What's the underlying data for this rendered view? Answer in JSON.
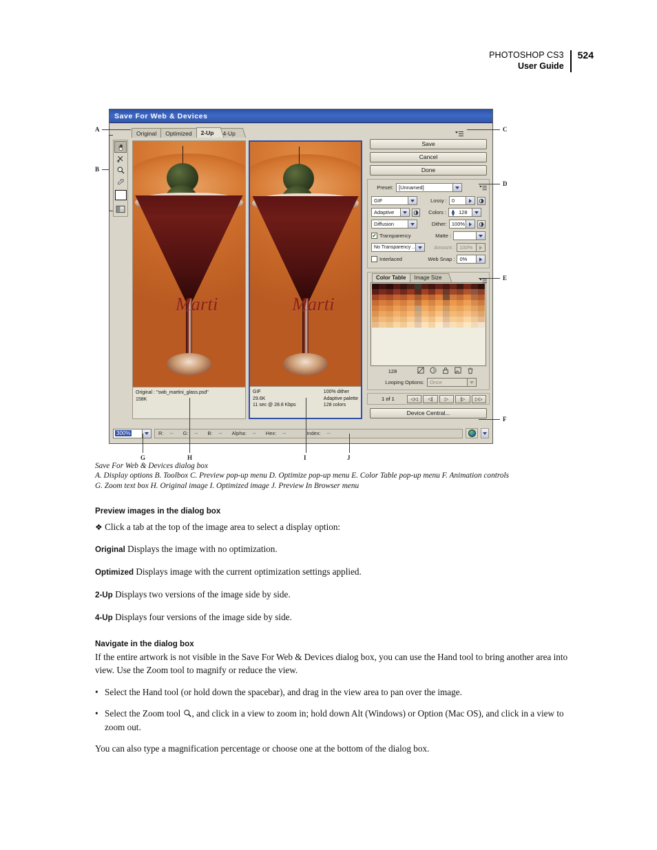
{
  "page_header": {
    "app": "PHOTOSHOP CS3",
    "guide": "User Guide",
    "page_number": "524"
  },
  "dialog": {
    "title": "Save For Web & Devices",
    "tabs": [
      {
        "label": "Original",
        "selected": false
      },
      {
        "label": "Optimized",
        "selected": false
      },
      {
        "label": "2-Up",
        "selected": true
      },
      {
        "label": "4-Up",
        "selected": false
      }
    ],
    "toolbox": [
      {
        "name": "hand-tool",
        "glyph": "✋",
        "active": true
      },
      {
        "name": "slice-select-tool",
        "glyph": "✂",
        "active": false
      },
      {
        "name": "zoom-tool",
        "glyph": "🔍",
        "active": false
      },
      {
        "name": "eyedropper-tool",
        "glyph": "✒",
        "active": false
      }
    ],
    "eyedropper_color": "#ffffff",
    "toggle_slices_label": "Toggle Slices Visibility",
    "buttons": {
      "save": "Save",
      "cancel": "Cancel",
      "done": "Done",
      "device_central": "Device Central..."
    },
    "panes": {
      "original": {
        "line1": "Original : \"swb_martini_glass.psd\"",
        "line2": "158K",
        "artwork_text": "Marti"
      },
      "optimized": {
        "left": [
          "GIF",
          "29.6K",
          "11 sec @ 28.8 Kbps"
        ],
        "right": [
          "100% dither",
          "Adaptive palette",
          "128 colors"
        ],
        "artwork_text": "Marti"
      }
    },
    "optimize": {
      "preset_label": "Preset:",
      "preset_value": "[Unnamed]",
      "format_value": "GIF",
      "palette_value": "Adaptive",
      "dither_algorithm_value": "Diffusion",
      "transparency_label": "Transparency",
      "transparency_checked": true,
      "transparency_dither_value": "No Transparency ..",
      "interlaced_label": "Interlaced",
      "interlaced_checked": false,
      "lossy_label": "Lossy :",
      "lossy_value": "0",
      "colors_label": "Colors :",
      "colors_value": "128",
      "dither_label": "Dither:",
      "dither_value": "100%",
      "matte_label": "Matte :",
      "matte_value": "",
      "amount_label": "Amount :",
      "amount_value": "100%",
      "amount_disabled": true,
      "web_snap_label": "Web Snap :",
      "web_snap_value": "0%"
    },
    "color_table": {
      "tabs": [
        {
          "label": "Color Table",
          "selected": true
        },
        {
          "label": "Image Size",
          "selected": false
        }
      ],
      "count": "128",
      "footer_icons": [
        "map-to-web-palette-icon",
        "transparency-icon",
        "lock-color-icon",
        "new-color-icon",
        "delete-color-icon"
      ],
      "swatch_colors": [
        "#2a0c08",
        "#3d1410",
        "#2c0d09",
        "#521a12",
        "#3a1410",
        "#4b2017",
        "#3c3a2e",
        "#561c13",
        "#431412",
        "#5e2016",
        "#4a1711",
        "#6a2418",
        "#3f1a13",
        "#73281a",
        "#4a1a12",
        "#2e100c",
        "#5b1d14",
        "#7a2a1b",
        "#66231a",
        "#8b3421",
        "#6e2a1c",
        "#97381f",
        "#5f2a1e",
        "#a54023",
        "#7b3220",
        "#b14a26",
        "#6b3a28",
        "#a14a2b",
        "#8b4226",
        "#b4552c",
        "#8a5844",
        "#8f3f25",
        "#a14726",
        "#b8562c",
        "#ab4f29",
        "#c46131",
        "#b55a2d",
        "#cf6c36",
        "#a85a33",
        "#d07134",
        "#bd6330",
        "#d97a3a",
        "#7c4e34",
        "#d2793c",
        "#c46a33",
        "#dd8340",
        "#b96b3e",
        "#b55c2f",
        "#c56b33",
        "#d97b3b",
        "#cf7436",
        "#e08a44",
        "#d77f3e",
        "#e7924a",
        "#c2753f",
        "#e79545",
        "#d98443",
        "#ec9b4e",
        "#ce7e42",
        "#e99a4c",
        "#e08c48",
        "#ef9f52",
        "#d98a4d",
        "#cc7a3f",
        "#d4803f",
        "#e4914b",
        "#dc8a46",
        "#eb9d53",
        "#e19450",
        "#f0a45c",
        "#bf9d78",
        "#f2a85f",
        "#e49b57",
        "#f4ae66",
        "#cf9a63",
        "#f0a95f",
        "#e9a25a",
        "#f3b068",
        "#e3a262",
        "#d89351",
        "#dc9452",
        "#eda65e",
        "#e49f5a",
        "#f2b069",
        "#e9a761",
        "#f5b771",
        "#cfa87c",
        "#f6bb78",
        "#eaae6b",
        "#f8c182",
        "#d8a97a",
        "#f4b975",
        "#efb370",
        "#f7c085",
        "#e9b37c",
        "#dfa469",
        "#e2a96b",
        "#f0b97a",
        "#e9b272",
        "#f5c285",
        "#eeba7b",
        "#f8cb92",
        "#d9b796",
        "#f9cf99",
        "#f0c287",
        "#fad7a4",
        "#e2bb94",
        "#f6cc93",
        "#f2c68c",
        "#f9d6a2",
        "#eec79a",
        "#e6b98a",
        "#e7ba8c",
        "#f3cd98",
        "#eec58e",
        "#f8d6a5",
        "#f2cc97",
        "#fbdfb3",
        "#e6c8ac",
        "#fce3ba",
        "#f4d3a4",
        "#fdeacb",
        "#ecd1ba",
        "#f9dfb5",
        "#f6d8ab",
        "#fbe7c2",
        "#f4d9b4",
        "#f2e0d0"
      ],
      "looping_label": "Looping Options:",
      "looping_value": "Once"
    },
    "animation": {
      "frame_label": "1 of 1",
      "buttons": [
        "first-frame",
        "previous-frame",
        "play",
        "next-frame",
        "last-frame"
      ],
      "glyphs": [
        "◁◁",
        "◁|",
        "▷",
        "|▷",
        "▷▷"
      ]
    },
    "status_bar": {
      "zoom_value": "300%",
      "fields": [
        {
          "label": "R:",
          "value": "--"
        },
        {
          "label": "G:",
          "value": "--"
        },
        {
          "label": "B:",
          "value": "--"
        },
        {
          "label": "Alpha:",
          "value": "--"
        },
        {
          "label": "Hex:",
          "value": "--"
        },
        {
          "label": "Index:",
          "value": "--"
        }
      ]
    }
  },
  "callouts": [
    {
      "letter": "A"
    },
    {
      "letter": "B"
    },
    {
      "letter": "C"
    },
    {
      "letter": "D"
    },
    {
      "letter": "E"
    },
    {
      "letter": "F"
    },
    {
      "letter": "G"
    },
    {
      "letter": "H"
    },
    {
      "letter": "I"
    },
    {
      "letter": "J"
    }
  ],
  "figure_caption": {
    "title": "Save For Web & Devices dialog box",
    "line1": "A. Display options  B. Toolbox  C. Preview pop-up menu  D. Optimize pop-up menu  E. Color Table pop-up menu  F. Animation controls",
    "line2": "G. Zoom text box  H. Original image  I. Optimized image  J. Preview In Browser menu"
  },
  "content": {
    "section1_heading": "Preview images in the dialog box",
    "section1_intro": "Click a tab at the top of the image area to select a display option:",
    "definitions": [
      {
        "term": "Original",
        "desc": "Displays the image with no optimization."
      },
      {
        "term": "Optimized",
        "desc": "Displays image with the current optimization settings applied."
      },
      {
        "term": "2-Up",
        "desc": "Displays two versions of the image side by side."
      },
      {
        "term": "4-Up",
        "desc": "Displays four versions of the image side by side."
      }
    ],
    "section2_heading": "Navigate in the dialog box",
    "section2_para": "If the entire artwork is not visible in the Save For Web & Devices dialog box, you can use the Hand tool to bring another area into view. Use the Zoom tool to magnify or reduce the view.",
    "bullet1": "Select the Hand tool  (or hold down the spacebar), and drag in the view area to pan over the image.",
    "bullet2_pre": "Select the Zoom tool",
    "bullet2_post": ", and click in a view to zoom in; hold down Alt (Windows) or Option (Mac OS), and click in a view to zoom out.",
    "closing_para": "You can also type a magnification percentage or choose one at the bottom of the dialog box."
  }
}
